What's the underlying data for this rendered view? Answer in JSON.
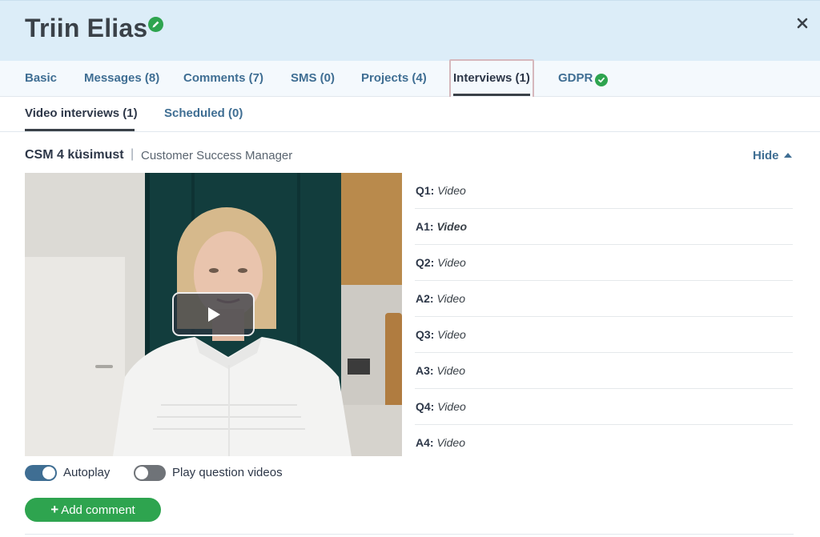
{
  "header": {
    "name": "Triin Elias",
    "edit_icon": "pencil-icon",
    "close_icon": "close-icon"
  },
  "tabs": [
    {
      "label": "Basic"
    },
    {
      "label": "Messages (8)"
    },
    {
      "label": "Comments (7)"
    },
    {
      "label": "SMS (0)"
    },
    {
      "label": "Projects (4)"
    },
    {
      "label": "Interviews (1)",
      "active": true
    },
    {
      "label": "GDPR",
      "icon": "check-circle-icon"
    }
  ],
  "subtabs": [
    {
      "label": "Video interviews (1)",
      "active": true
    },
    {
      "label": "Scheduled (0)"
    }
  ],
  "interview": {
    "title": "CSM 4 küsimust",
    "separator": "|",
    "position": "Customer Success Manager",
    "hide_label": "Hide"
  },
  "qa": [
    {
      "label": "Q1:",
      "value": "Video"
    },
    {
      "label": "A1:",
      "value": "Video",
      "selected": true
    },
    {
      "label": "Q2:",
      "value": "Video"
    },
    {
      "label": "A2:",
      "value": "Video"
    },
    {
      "label": "Q3:",
      "value": "Video"
    },
    {
      "label": "A3:",
      "value": "Video"
    },
    {
      "label": "Q4:",
      "value": "Video"
    },
    {
      "label": "A4:",
      "value": "Video"
    }
  ],
  "toggles": {
    "autoplay": {
      "label": "Autoplay",
      "on": true
    },
    "question_videos": {
      "label": "Play question videos",
      "on": false
    }
  },
  "add_comment": {
    "label": "Add comment"
  },
  "colors": {
    "header_bg": "#dcedf8",
    "link": "#3f6e93",
    "accent_green": "#2ea44f",
    "toggle_on": "#3f6e93",
    "toggle_off": "#6f7378"
  }
}
